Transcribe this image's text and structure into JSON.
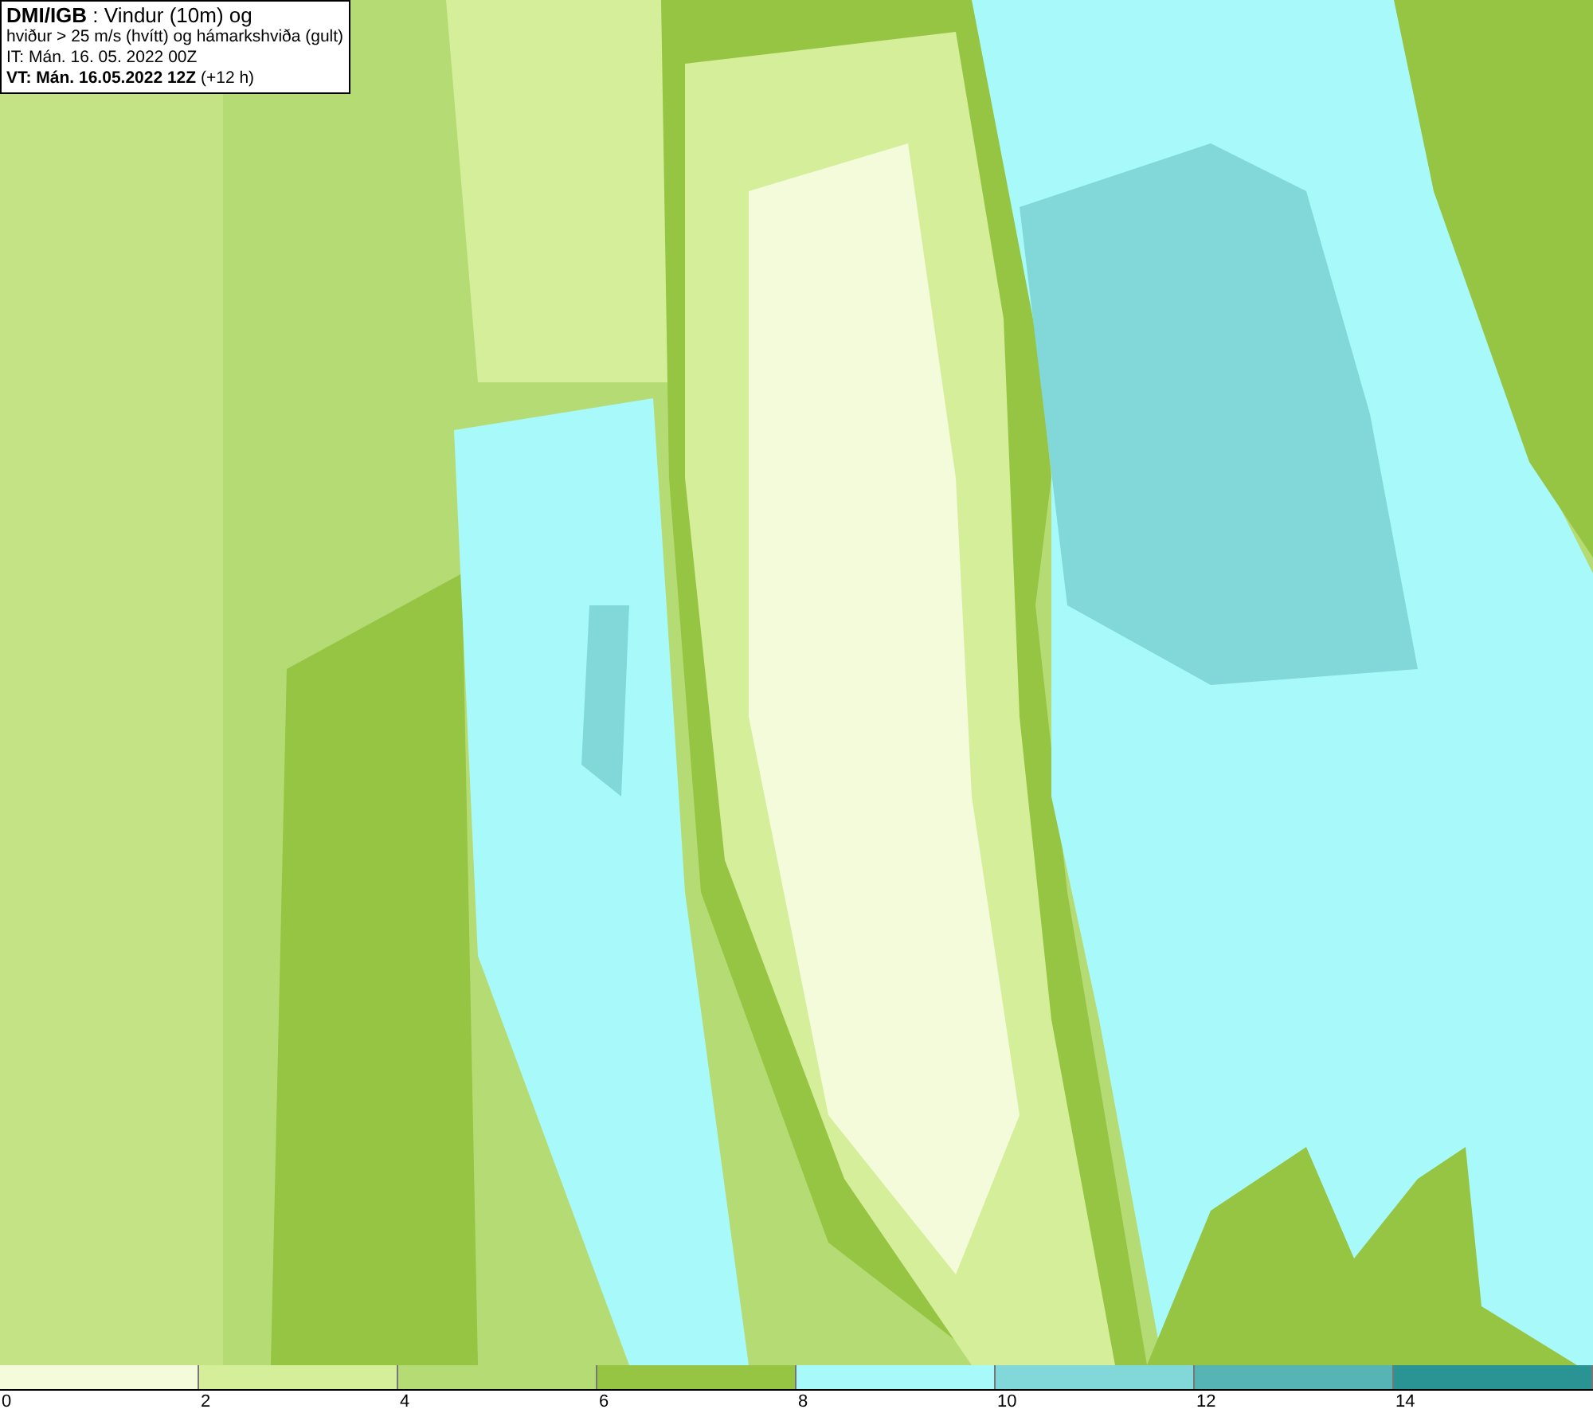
{
  "title_box": {
    "lines": [
      "**DMI/IGB** : Vindur (10m) og",
      "hviður > 25 m/s (hvítt) og hámarkshviða (gult)",
      "IT: Mán. 16. 05. 2022 00Z",
      "**VT: Mán. 16.05.2022 12Z** (+12 h)"
    ]
  },
  "legend": {
    "bins": [
      {
        "color": "#f4fbda",
        "label": "0"
      },
      {
        "color": "#d5ee9a",
        "label": "2"
      },
      {
        "color": "#b5db74",
        "label": "4"
      },
      {
        "color": "#96c443",
        "label": "6"
      },
      {
        "color": "#a8fafa",
        "label": "8"
      },
      {
        "color": "#82d8d8",
        "label": "10"
      },
      {
        "color": "#56b4b4",
        "label": "12"
      },
      {
        "color": "#2a9494",
        "label": "14"
      }
    ]
  }
}
